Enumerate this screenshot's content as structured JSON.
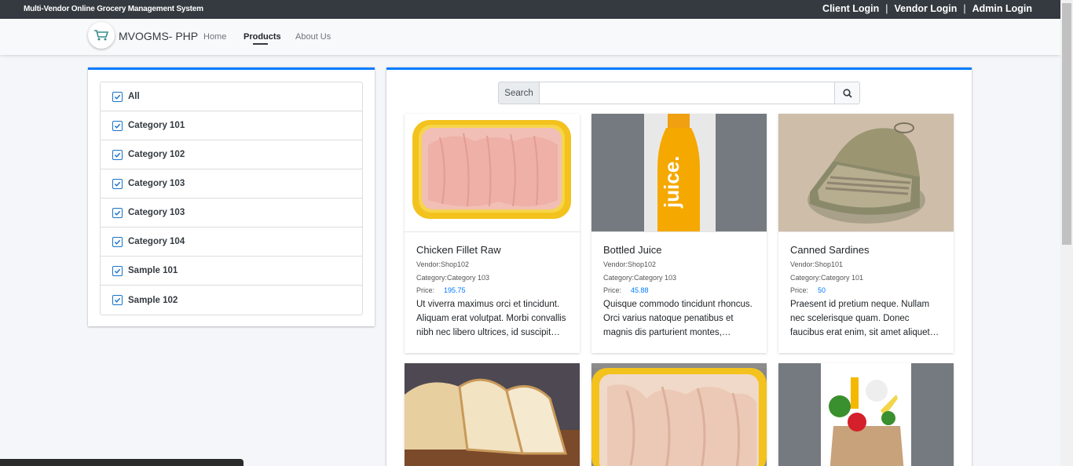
{
  "topbar": {
    "system_title": "Multi-Vendor Online Grocery Management System",
    "client_login": "Client Login",
    "vendor_login": "Vendor Login",
    "admin_login": "Admin Login",
    "separator": "|"
  },
  "navbar": {
    "brand": "MVOGMS- PHP",
    "links": [
      "Home",
      "Products",
      "About Us"
    ],
    "active": "Products"
  },
  "categories": [
    "All",
    "Category 101",
    "Category 102",
    "Category 103",
    "Category 103",
    "Category 104",
    "Sample 101",
    "Sample 102"
  ],
  "search": {
    "addon_label": "Search",
    "value": ""
  },
  "products": [
    {
      "name": "Chicken Fillet Raw",
      "vendor": "Vendor:Shop102",
      "category": "Category:Category 103",
      "price_label": "Price:",
      "price": "195.75",
      "description": "Ut viverra maximus orci et tincidunt. Aliquam erat volutpat. Morbi convallis nibh nec libero ultrices, id suscipit nunc."
    },
    {
      "name": "Bottled Juice",
      "vendor": "Vendor:Shop102",
      "category": "Category:Category 103",
      "price_label": "Price:",
      "price": "45.88",
      "description": "Quisque commodo tincidunt rhoncus. Orci varius natoque penatibus et magnis dis parturient montes, nascetur."
    },
    {
      "name": "Canned Sardines",
      "vendor": "Vendor:Shop101",
      "category": "Category:Category 101",
      "price_label": "Price:",
      "price": "50",
      "description": "Praesent id pretium neque. Nullam nec scelerisque quam. Donec faucibus erat enim, sit amet aliquet ipsum aliquam."
    }
  ],
  "colors": {
    "accent": "#007bff",
    "topbar_bg": "#343a40",
    "checkbox": "#1a73c9"
  }
}
